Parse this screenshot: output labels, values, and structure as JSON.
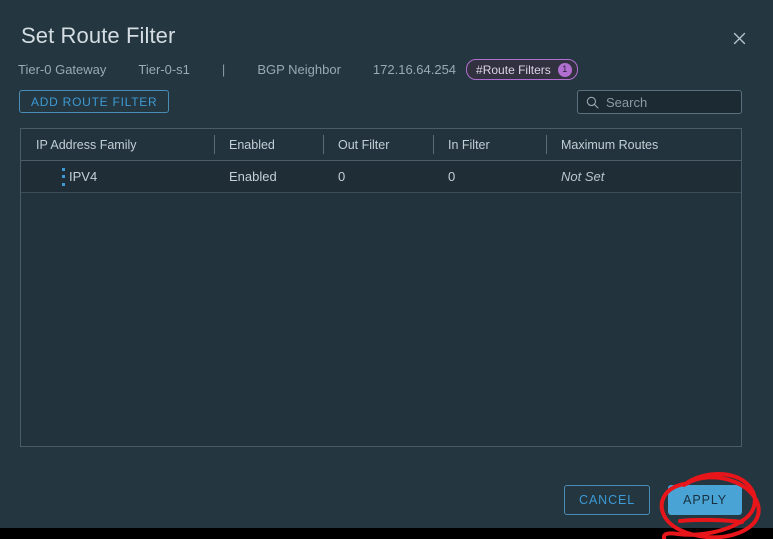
{
  "dialog": {
    "title": "Set Route Filter",
    "close_icon": "close-icon"
  },
  "breadcrumb": {
    "gateway_label": "Tier-0 Gateway",
    "gateway_value": "Tier-0-s1",
    "separator": "|",
    "neighbor_label": "BGP Neighbor",
    "neighbor_ip": "172.16.64.254",
    "chip_label": "#Route Filters",
    "chip_count": "1",
    "chip_border_color": "#b06fd0",
    "chip_accent_color": "#b06fd0"
  },
  "toolbar": {
    "add_route_filter_label": "ADD ROUTE FILTER",
    "search_placeholder": "Search",
    "search_value": "",
    "search_icon": "search-icon"
  },
  "table": {
    "columns": [
      "IP Address Family",
      "Enabled",
      "Out Filter",
      "In Filter",
      "Maximum Routes"
    ],
    "rows": [
      {
        "ip_address_family": "IPV4",
        "enabled": "Enabled",
        "out_filter": "0",
        "in_filter": "0",
        "maximum_routes": "Not Set",
        "kebab_icon": "kebab-menu-icon"
      }
    ]
  },
  "footer": {
    "cancel_label": "CANCEL",
    "apply_label": "APPLY",
    "apply_bg_color": "#49a3d4",
    "accent_color": "#3d9ad4"
  },
  "annotation": {
    "shape": "hand-drawn-ellipse",
    "color": "#e8161a",
    "targets": "apply-button"
  },
  "theme": {
    "background": "#243640",
    "panel_background": "#22333d",
    "row_background": "#1e2d36",
    "border": "#4a5c67",
    "text_primary": "#d4dde2",
    "text_secondary": "#9aa9b2"
  }
}
